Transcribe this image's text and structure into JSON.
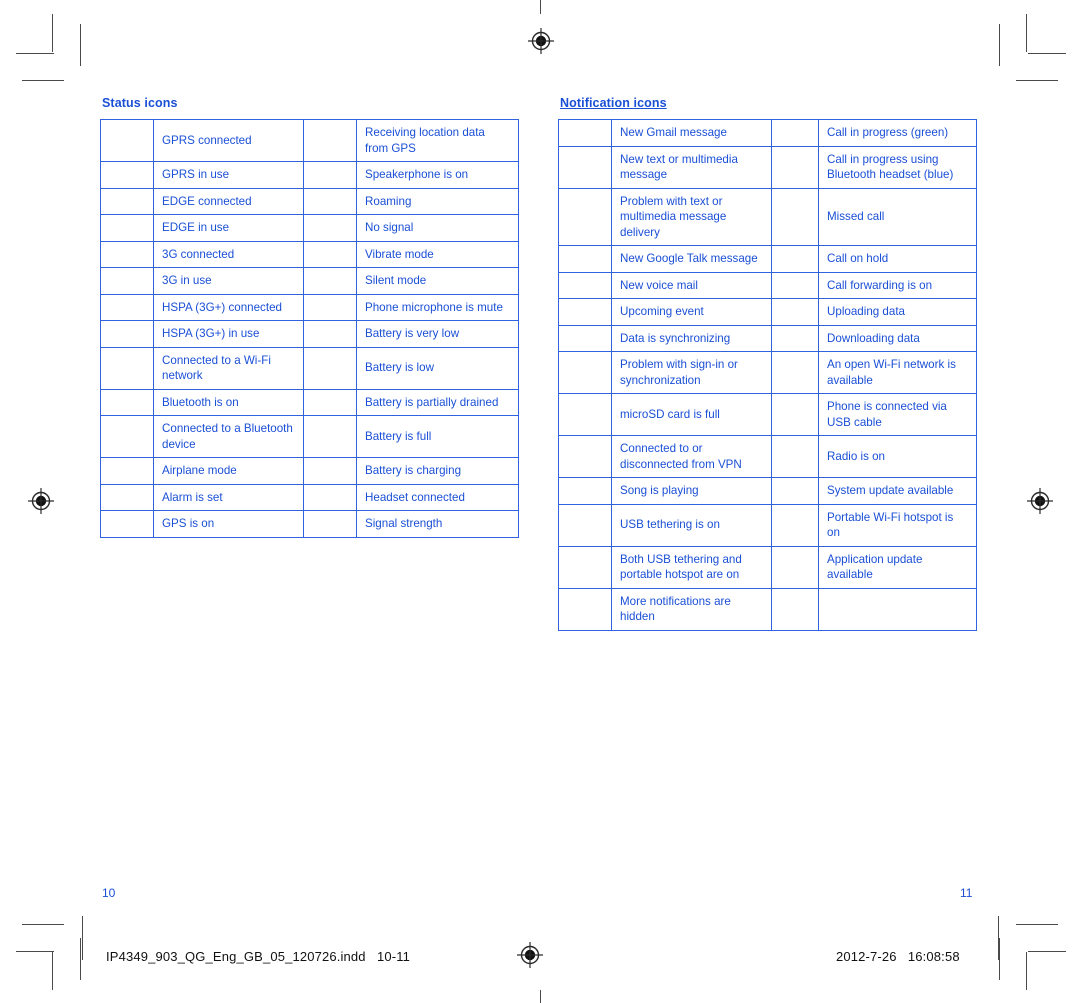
{
  "document": {
    "page_left_number": "10",
    "page_right_number": "11",
    "footer_filename": "IP4349_903_QG_Eng_GB_05_120726.indd   10-11",
    "footer_datetime": "2012-7-26   16:08:58",
    "accent_color": "#1a4fd6",
    "border_color": "#2f63e0",
    "mark_color": "#4a4a4a"
  },
  "status_section": {
    "title": "Status icons",
    "rows": [
      {
        "left_icon": "gprs-connected-icon",
        "left_label": "GPRS connected",
        "right_icon": "gps-location-icon",
        "right_label": "Receiving location data from GPS"
      },
      {
        "left_icon": "gprs-in-use-icon",
        "left_label": "GPRS in use",
        "right_icon": "speakerphone-icon",
        "right_label": "Speakerphone is on"
      },
      {
        "left_icon": "edge-connected-icon",
        "left_label": "EDGE connected",
        "right_icon": "roaming-icon",
        "right_label": "Roaming"
      },
      {
        "left_icon": "edge-in-use-icon",
        "left_label": "EDGE in use",
        "right_icon": "no-signal-icon",
        "right_label": "No signal"
      },
      {
        "left_icon": "3g-connected-icon",
        "left_label": "3G connected",
        "right_icon": "vibrate-mode-icon",
        "right_label": "Vibrate mode"
      },
      {
        "left_icon": "3g-in-use-icon",
        "left_label": "3G in use",
        "right_icon": "silent-mode-icon",
        "right_label": "Silent mode"
      },
      {
        "left_icon": "hspa-connected-icon",
        "left_label": "HSPA (3G+) connected",
        "right_icon": "microphone-mute-icon",
        "right_label": "Phone microphone is mute"
      },
      {
        "left_icon": "hspa-in-use-icon",
        "left_label": "HSPA (3G+) in use",
        "right_icon": "battery-very-low-icon",
        "right_label": "Battery is very low"
      },
      {
        "left_icon": "wifi-connected-icon",
        "left_label": "Connected to a Wi-Fi network",
        "right_icon": "battery-low-icon",
        "right_label": "Battery is low"
      },
      {
        "left_icon": "bluetooth-on-icon",
        "left_label": "Bluetooth is on",
        "right_icon": "battery-partial-icon",
        "right_label": "Battery is partially drained"
      },
      {
        "left_icon": "bluetooth-connected-icon",
        "left_label": "Connected to a Bluetooth device",
        "right_icon": "battery-full-icon",
        "right_label": "Battery is full"
      },
      {
        "left_icon": "airplane-mode-icon",
        "left_label": "Airplane mode",
        "right_icon": "battery-charging-icon",
        "right_label": "Battery is charging"
      },
      {
        "left_icon": "alarm-icon",
        "left_label": "Alarm is set",
        "right_icon": "headset-icon",
        "right_label": "Headset connected"
      },
      {
        "left_icon": "gps-on-icon",
        "left_label": "GPS is on",
        "right_icon": "signal-strength-icon",
        "right_label": "Signal strength"
      }
    ]
  },
  "notification_section": {
    "title": "Notification icons",
    "rows": [
      {
        "left_icon": "gmail-icon",
        "left_label": "New Gmail message",
        "right_icon": "call-in-progress-icon",
        "right_label": "Call in progress (green)"
      },
      {
        "left_icon": "sms-mms-icon",
        "left_label": "New text or multimedia message",
        "right_icon": "call-bluetooth-icon",
        "right_label": "Call in progress using Bluetooth headset (blue)"
      },
      {
        "left_icon": "sms-problem-icon",
        "left_label": "Problem with text or multimedia message delivery",
        "right_icon": "missed-call-icon",
        "right_label": "Missed call"
      },
      {
        "left_icon": "google-talk-icon",
        "left_label": "New Google Talk message",
        "right_icon": "call-on-hold-icon",
        "right_label": "Call on hold"
      },
      {
        "left_icon": "voicemail-icon",
        "left_label": "New voice mail",
        "right_icon": "call-forwarding-icon",
        "right_label": "Call forwarding is on"
      },
      {
        "left_icon": "calendar-event-icon",
        "left_label": "Upcoming event",
        "right_icon": "upload-icon",
        "right_label": "Uploading data"
      },
      {
        "left_icon": "sync-icon",
        "left_label": "Data is synchronizing",
        "right_icon": "download-icon",
        "right_label": "Downloading data"
      },
      {
        "left_icon": "sync-problem-icon",
        "left_label": "Problem with sign-in or synchronization",
        "right_icon": "open-wifi-icon",
        "right_label": "An open Wi-Fi network is available"
      },
      {
        "left_icon": "sdcard-full-icon",
        "left_label": "microSD card is full",
        "right_icon": "usb-connected-icon",
        "right_label": "Phone is connected via USB cable"
      },
      {
        "left_icon": "vpn-icon",
        "left_label": "Connected to or disconnected from VPN",
        "right_icon": "radio-icon",
        "right_label": "Radio is on"
      },
      {
        "left_icon": "music-playing-icon",
        "left_label": "Song is playing",
        "right_icon": "system-update-icon",
        "right_label": "System update available"
      },
      {
        "left_icon": "usb-tethering-icon",
        "left_label": "USB tethering is on",
        "right_icon": "wifi-hotspot-icon",
        "right_label": "Portable Wi-Fi hotspot is on"
      },
      {
        "left_icon": "tethering-hotspot-icon",
        "left_label": "Both USB tethering and portable hotspot are on",
        "right_icon": "app-update-icon",
        "right_label": "Application update available"
      },
      {
        "left_icon": "more-notifications-icon",
        "left_label": "More notifications are hidden",
        "right_icon": "",
        "right_label": ""
      }
    ]
  }
}
